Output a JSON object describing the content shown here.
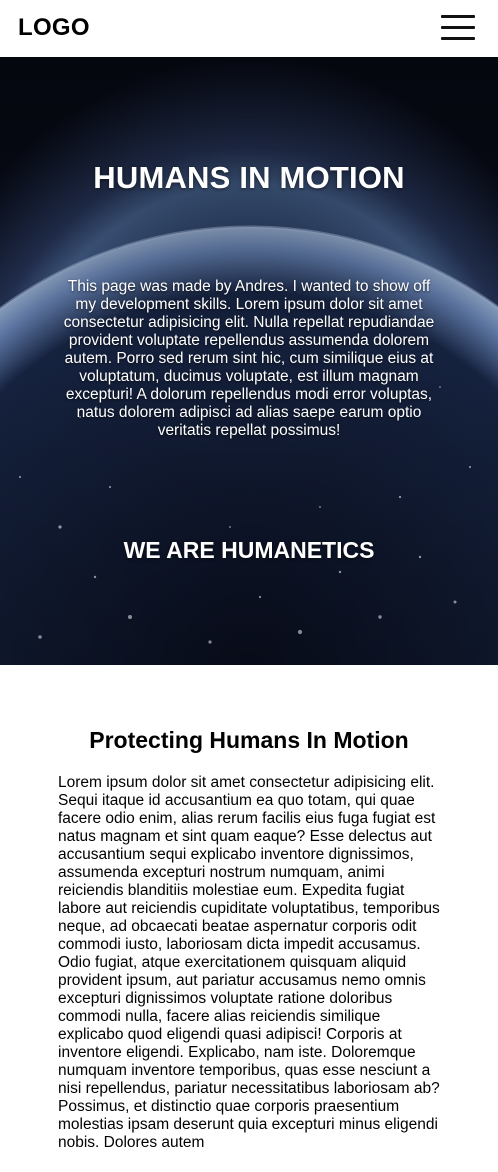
{
  "navbar": {
    "logo": "LOGO",
    "menu_icon": "hamburger-menu-icon"
  },
  "hero": {
    "background": "earth-from-space-at-night",
    "title": "HUMANS IN MOTION",
    "text": "This page was made by Andres. I wanted to show off my development skills. Lorem ipsum dolor sit amet consectetur adipisicing elit. Nulla repellat repudiandae provident voluptate repellendus assumenda dolorem autem. Porro sed rerum sint hic, cum similique eius at voluptatum, ducimus voluptate, est illum magnam excepturi! A dolorum repellendus modi error voluptas, natus dolorem adipisci ad alias saepe earum optio veritatis repellat possimus!",
    "subtitle": "WE ARE HUMANETICS"
  },
  "section": {
    "title": "Protecting Humans In Motion",
    "body": "Lorem ipsum dolor sit amet consectetur adipisicing elit. Sequi itaque id accusantium ea quo totam, qui quae facere odio enim, alias rerum facilis eius fuga fugiat est natus magnam et sint quam eaque? Esse delectus aut accusantium sequi explicabo inventore dignissimos, assumenda excepturi nostrum numquam, animi reiciendis blanditiis molestiae eum. Expedita fugiat labore aut reiciendis cupiditate voluptatibus, temporibus neque, ad obcaecati beatae aspernatur corporis odit commodi iusto, laboriosam dicta impedit accusamus. Odio fugiat, atque exercitationem quisquam aliquid provident ipsum, aut pariatur accusamus nemo omnis excepturi dignissimos voluptate ratione doloribus commodi nulla, facere alias reiciendis similique explicabo quod eligendi quasi adipisci! Corporis at inventore eligendi. Explicabo, nam iste. Doloremque numquam inventore temporibus, quas esse nesciunt a nisi repellendus, pariatur necessitatibus laboriosam ab? Possimus, et distinctio quae corporis praesentium molestias ipsam deserunt quia excepturi minus eligendi nobis. Dolores autem"
  }
}
